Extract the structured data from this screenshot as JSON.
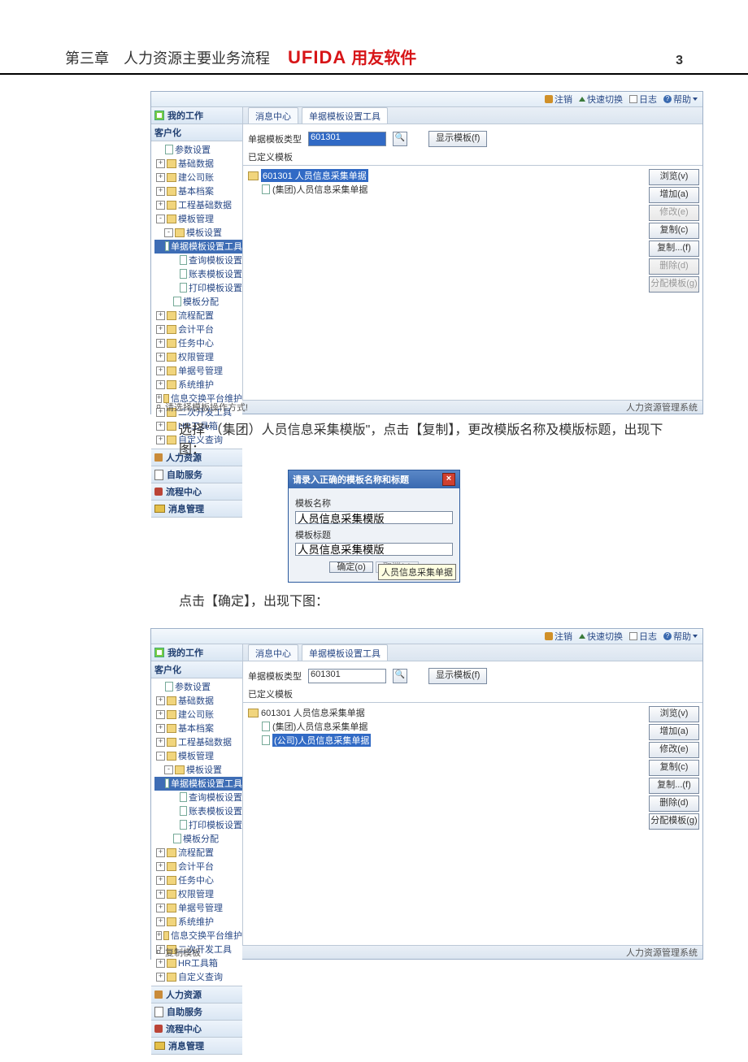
{
  "header": {
    "chapter": "第三章　人力资源主要业务流程",
    "logo_en": "UFIDA",
    "logo_cn": "用友软件",
    "page_num": "3"
  },
  "toolbar": {
    "exit": "注销",
    "switch": "快速切换",
    "log": "日志",
    "help": "帮助"
  },
  "sidebar": {
    "my_work": "我的工作",
    "khh": "客户化",
    "tree": [
      {
        "lvl": 0,
        "exp": "",
        "kind": "pg",
        "label": "参数设置"
      },
      {
        "lvl": 0,
        "exp": "+",
        "kind": "f",
        "label": "基础数据"
      },
      {
        "lvl": 0,
        "exp": "+",
        "kind": "f",
        "label": "建公司账"
      },
      {
        "lvl": 0,
        "exp": "+",
        "kind": "f",
        "label": "基本档案"
      },
      {
        "lvl": 0,
        "exp": "+",
        "kind": "f",
        "label": "工程基础数据"
      },
      {
        "lvl": 0,
        "exp": "-",
        "kind": "f",
        "label": "模板管理"
      },
      {
        "lvl": 1,
        "exp": "-",
        "kind": "f",
        "label": "模板设置"
      },
      {
        "lvl": 2,
        "exp": "",
        "kind": "pg",
        "label": "单据模板设置工具",
        "sel": true
      },
      {
        "lvl": 2,
        "exp": "",
        "kind": "pg",
        "label": "查询模板设置"
      },
      {
        "lvl": 2,
        "exp": "",
        "kind": "pg",
        "label": "账表模板设置"
      },
      {
        "lvl": 2,
        "exp": "",
        "kind": "pg",
        "label": "打印模板设置"
      },
      {
        "lvl": 1,
        "exp": "",
        "kind": "pg",
        "label": "模板分配"
      },
      {
        "lvl": 0,
        "exp": "+",
        "kind": "f",
        "label": "流程配置"
      },
      {
        "lvl": 0,
        "exp": "+",
        "kind": "f",
        "label": "会计平台"
      },
      {
        "lvl": 0,
        "exp": "+",
        "kind": "f",
        "label": "任务中心"
      },
      {
        "lvl": 0,
        "exp": "+",
        "kind": "f",
        "label": "权限管理"
      },
      {
        "lvl": 0,
        "exp": "+",
        "kind": "f",
        "label": "单据号管理"
      },
      {
        "lvl": 0,
        "exp": "+",
        "kind": "f",
        "label": "系统维护"
      },
      {
        "lvl": 0,
        "exp": "+",
        "kind": "f",
        "label": "信息交换平台维护"
      },
      {
        "lvl": 0,
        "exp": "+",
        "kind": "f",
        "label": "二次开发工具"
      },
      {
        "lvl": 0,
        "exp": "+",
        "kind": "f",
        "label": "HR工具箱"
      },
      {
        "lvl": 0,
        "exp": "+",
        "kind": "f",
        "label": "自定义查询"
      }
    ],
    "bottom": {
      "hr": "人力资源",
      "self": "自助服务",
      "flow": "流程中心",
      "msg": "消息管理"
    }
  },
  "tabs": {
    "center": "消息中心",
    "tool": "单据模板设置工具"
  },
  "form": {
    "label": "单据模板类型",
    "value": "601301",
    "show_btn": "显示模板(f)",
    "section": "已定义模板"
  },
  "treeA": [
    {
      "kind": "fy",
      "label": "601301 人员信息采集单据",
      "sel": true
    },
    {
      "kind": "pg",
      "label": "(集团)人员信息采集单据",
      "indent": true
    }
  ],
  "treeB": [
    {
      "kind": "fy",
      "label": "601301 人员信息采集单据"
    },
    {
      "kind": "pg",
      "label": "(集团)人员信息采集单据",
      "indent": true
    },
    {
      "kind": "pg",
      "label": "(公司)人员信息采集单据",
      "indent": true,
      "sel": true
    }
  ],
  "vbtns": {
    "browse": "浏览(v)",
    "add": "增加(a)",
    "edit": "修改(e)",
    "copy": "复制(c)",
    "copy2": "复制...(f)",
    "del": "删除(d)",
    "assign": "分配模板(g)"
  },
  "statusA": {
    "left": "请选择模板操作方式!",
    "right": "人力资源管理系统"
  },
  "statusB": {
    "left": "复制模板",
    "right": "人力资源管理系统"
  },
  "desc1": "选择\"（集团）人员信息采集模版\"，点击【复制】，更改模版名称及模版标题，出现下图：",
  "desc2": "点击【确定】，出现下图：",
  "dialog": {
    "title": "请录入正确的模板名称和标题",
    "name_lbl": "模板名称",
    "name_val": "人员信息采集模版",
    "title_lbl": "模板标题",
    "title_val": "人员信息采集模版",
    "ok": "确定(o)",
    "cancel": "取消(c)",
    "tooltip": "人员信息采集单据"
  }
}
